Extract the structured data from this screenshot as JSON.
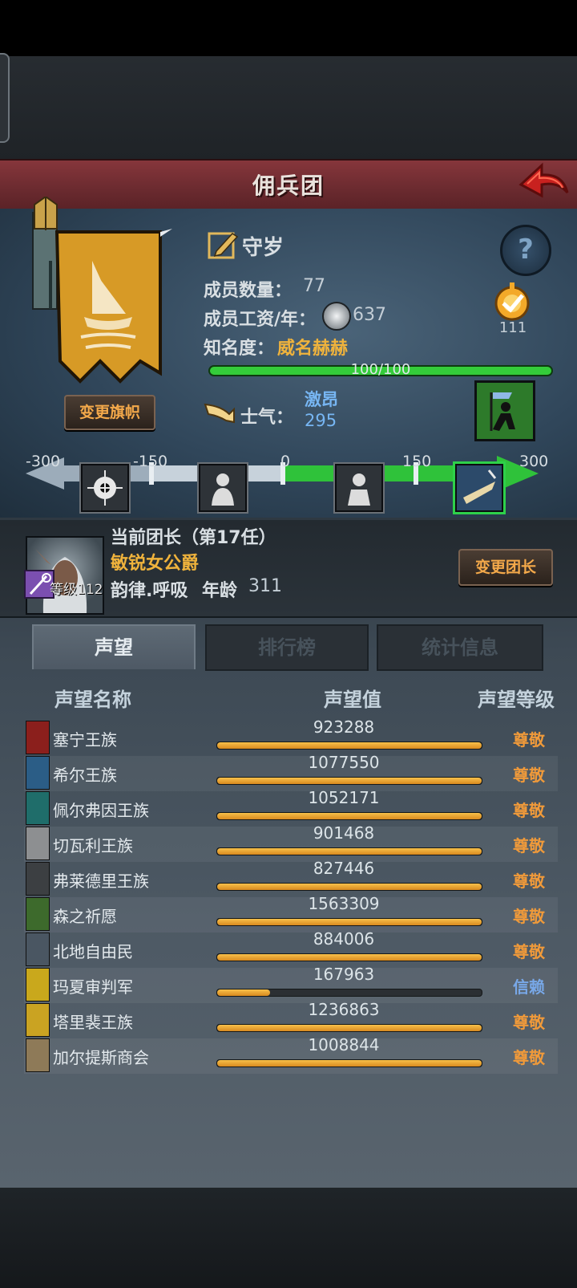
{
  "title": "佣兵团",
  "guild": {
    "name": "守岁",
    "member_count_label": "成员数量：",
    "member_count": "77",
    "salary_label": "成员工资/年：",
    "salary": "637",
    "fame_label": "知名度：",
    "fame_value": "威名赫赫",
    "fame_progress_text": "100/100",
    "fame_progress": 1.0,
    "badge_number": "111",
    "change_flag_button": "变更旗帜"
  },
  "morale": {
    "label": "士气：",
    "state": "激昂",
    "value": "295",
    "axis_ticks": [
      "-300",
      "-150",
      "0",
      "150",
      "300"
    ],
    "level_value": 295
  },
  "leader": {
    "title": "当前团长（第17任）",
    "name": "敏锐女公爵",
    "level": "等级112",
    "traits": "韵律.呼吸",
    "age_label": "年龄",
    "age": "311",
    "change_button": "变更团长"
  },
  "tabs": [
    {
      "label": "声望",
      "active": true
    },
    {
      "label": "排行榜",
      "active": false
    },
    {
      "label": "统计信息",
      "active": false
    }
  ],
  "table_headers": {
    "name": "声望名称",
    "value": "声望值",
    "rank": "声望等级"
  },
  "reputation_rows": [
    {
      "name": "塞宁王族",
      "value": "923288",
      "rank": "尊敬",
      "fill": 1.0,
      "crest_color": "#8b1f1c"
    },
    {
      "name": "希尔王族",
      "value": "1077550",
      "rank": "尊敬",
      "fill": 1.0,
      "crest_color": "#2b5d86"
    },
    {
      "name": "佩尔弗因王族",
      "value": "1052171",
      "rank": "尊敬",
      "fill": 1.0,
      "crest_color": "#1f6d6a"
    },
    {
      "name": "切瓦利王族",
      "value": "901468",
      "rank": "尊敬",
      "fill": 1.0,
      "crest_color": "#8d8f91"
    },
    {
      "name": "弗莱德里王族",
      "value": "827446",
      "rank": "尊敬",
      "fill": 1.0,
      "crest_color": "#3c3f42"
    },
    {
      "name": "森之祈愿",
      "value": "1563309",
      "rank": "尊敬",
      "fill": 1.0,
      "crest_color": "#3d6a2c"
    },
    {
      "name": "北地自由民",
      "value": "884006",
      "rank": "尊敬",
      "fill": 1.0,
      "crest_color": "#4a5662"
    },
    {
      "name": "玛夏审判军",
      "value": "167963",
      "rank": "信赖",
      "fill": 0.2,
      "crest_color": "#c9a81c"
    },
    {
      "name": "塔里裴王族",
      "value": "1236863",
      "rank": "尊敬",
      "fill": 1.0,
      "crest_color": "#caa322"
    },
    {
      "name": "加尔提斯商会",
      "value": "1008844",
      "rank": "尊敬",
      "fill": 1.0,
      "crest_color": "#8e7a58"
    }
  ],
  "colors": {
    "rank_respect": "#f09a3a",
    "rank_trust": "#78a8e8"
  }
}
